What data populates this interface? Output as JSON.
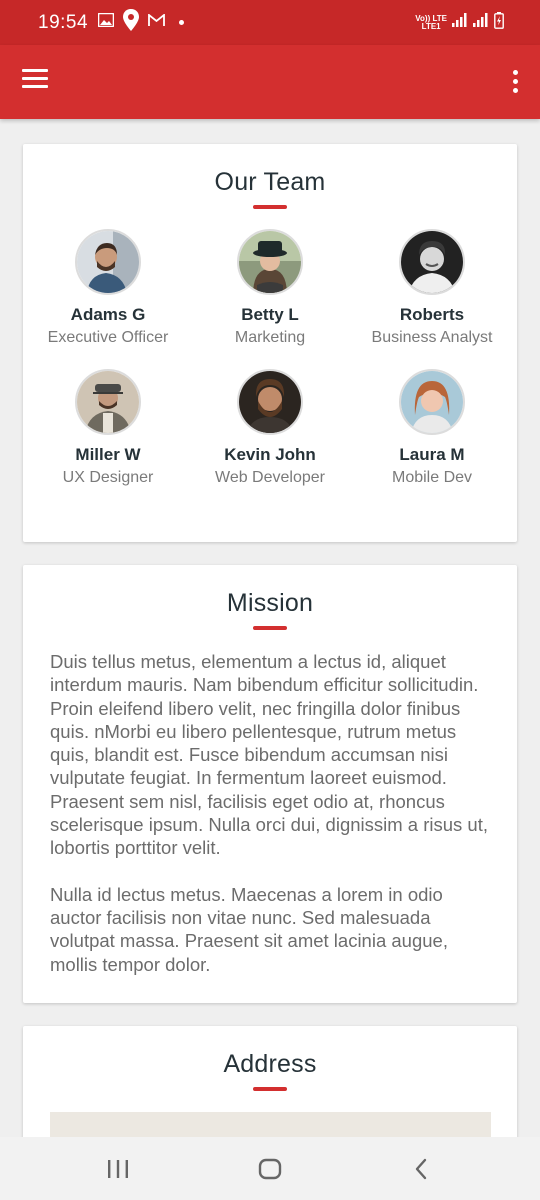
{
  "status_bar": {
    "time": "19:54",
    "network_top": "Vo)) LTE",
    "network_bottom": "LTE1"
  },
  "app_bar": {
    "menu_icon": "hamburger-menu-icon",
    "more_icon": "more-vert-icon"
  },
  "team": {
    "title": "Our Team",
    "members": [
      {
        "name": "Adams G",
        "role": "Executive Officer"
      },
      {
        "name": "Betty L",
        "role": "Marketing"
      },
      {
        "name": "Roberts",
        "role": "Business Analyst"
      },
      {
        "name": "Miller W",
        "role": "UX Designer"
      },
      {
        "name": "Kevin John",
        "role": "Web Developer"
      },
      {
        "name": "Laura M",
        "role": "Mobile Dev"
      }
    ]
  },
  "mission": {
    "title": "Mission",
    "paragraphs": [
      "Duis tellus metus, elementum a lectus id, aliquet interdum mauris. Nam bibendum efficitur sollicitudin. Proin eleifend libero velit, nec fringilla dolor finibus quis. nMorbi eu libero pellentesque, rutrum metus quis, blandit est. Fusce bibendum accumsan nisi vulputate feugiat. In fermentum laoreet euismod. Praesent sem nisl, facilisis eget odio at, rhoncus scelerisque ipsum. Nulla orci dui, dignissim a risus ut, lobortis porttitor velit.",
      "Nulla id lectus metus. Maecenas a lorem in odio auctor facilisis non vitae nunc. Sed malesuada volutpat massa. Praesent sit amet lacinia augue, mollis tempor dolor."
    ]
  },
  "address": {
    "title": "Address"
  },
  "colors": {
    "status_bar": "#c62828",
    "app_bar": "#d32f2f",
    "accent": "#d32f2f",
    "background": "#efefef"
  }
}
